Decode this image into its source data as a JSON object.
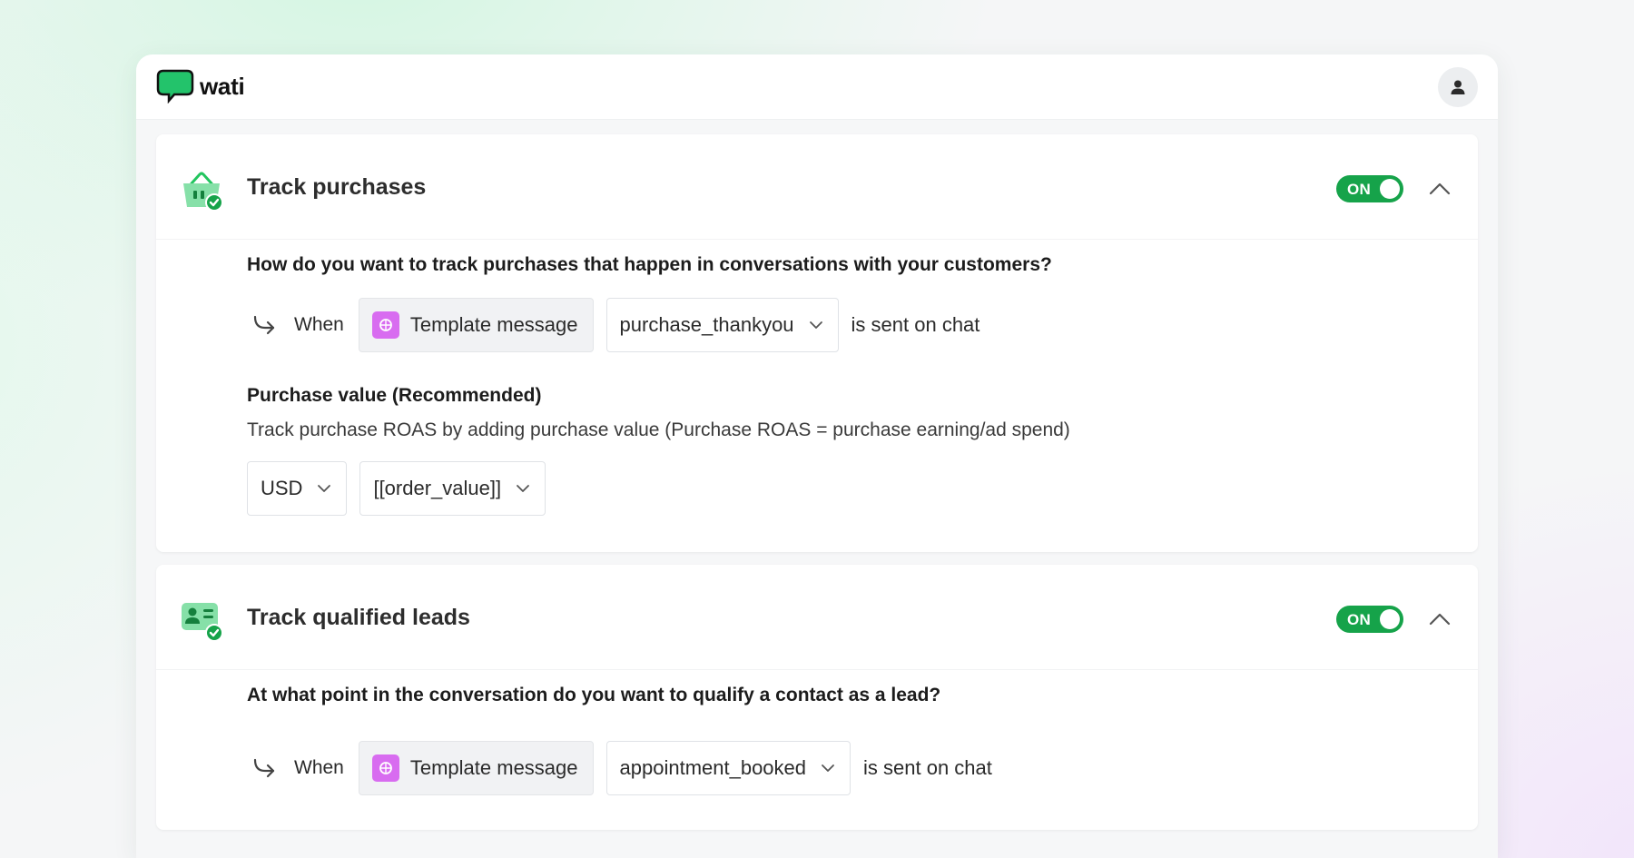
{
  "brand": {
    "name": "wati",
    "accent": "#16a34a",
    "logo_icon": "chat-bubble-icon"
  },
  "header": {
    "profile_icon": "user-icon"
  },
  "cards": [
    {
      "title": "Track purchases",
      "icon": "shopping-basket-check-icon",
      "toggle": {
        "label": "ON",
        "state": true
      },
      "question": "How do you want to track purchases that happen in conversations with your customers?",
      "rule": {
        "when": "When",
        "type": "Template message",
        "template": "purchase_thankyou",
        "suffix": "is sent on chat"
      },
      "purchase_value": {
        "title": "Purchase value (Recommended)",
        "description": "Track purchase ROAS by adding purchase value (Purchase ROAS = purchase earning/ad spend)",
        "currency": "USD",
        "value_field": "[[order_value]]"
      }
    },
    {
      "title": "Track qualified leads",
      "icon": "contact-card-check-icon",
      "toggle": {
        "label": "ON",
        "state": true
      },
      "question": "At what point in the conversation do you want to qualify a contact as a lead?",
      "rule": {
        "when": "When",
        "type": "Template message",
        "template": "appointment_booked",
        "suffix": "is sent on chat"
      }
    }
  ],
  "colors": {
    "toggle_on": "#16a34a",
    "chip_icon": "#d86cf0",
    "icon_green": "#22c55e"
  }
}
